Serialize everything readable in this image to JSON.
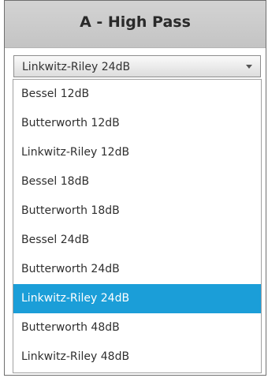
{
  "panel": {
    "title": "A - High Pass"
  },
  "select": {
    "value": "Linkwitz-Riley 24dB"
  },
  "options": [
    "Bessel 12dB",
    "Butterworth 12dB",
    "Linkwitz-Riley 12dB",
    "Bessel 18dB",
    "Butterworth 18dB",
    "Bessel 24dB",
    "Butterworth 24dB",
    "Linkwitz-Riley 24dB",
    "Butterworth 48dB",
    "Linkwitz-Riley 48dB"
  ],
  "selected_option": "Linkwitz-Riley 24dB",
  "colors": {
    "selection": "#1b9ed8",
    "header_bg": "#c8c8c8"
  }
}
